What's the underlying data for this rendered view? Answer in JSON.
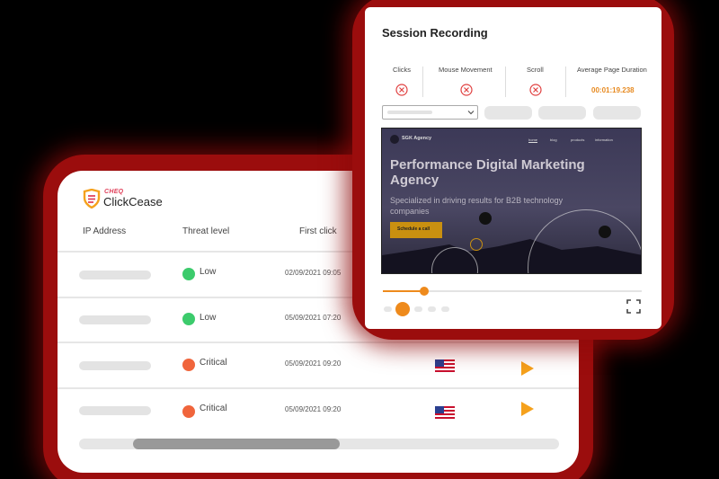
{
  "clickcease": {
    "brand_tag": "CHEQ",
    "brand_name": "ClickCease",
    "columns": [
      "IP Address",
      "Threat level",
      "First click"
    ],
    "rows": [
      {
        "threat": "Low",
        "status_color": "#3ccb6c",
        "first_click": "02/09/2021  09:05",
        "has_details": false
      },
      {
        "threat": "Low",
        "status_color": "#3ccb6c",
        "first_click": "05/09/2021  07:20",
        "has_details": false
      },
      {
        "threat": "Critical",
        "status_color": "#f0653c",
        "first_click": "05/09/2021  09:20",
        "has_details": true,
        "flag_icon": "us-flag-icon"
      },
      {
        "threat": "Critical",
        "status_color": "#f0653c",
        "first_click": "05/09/2021  09:20",
        "has_details": true,
        "flag_icon": "us-flag-icon"
      }
    ]
  },
  "session": {
    "title": "Session Recording",
    "metrics": [
      {
        "label": "Clicks",
        "icon": "x-circle-icon"
      },
      {
        "label": "Mouse Movement",
        "icon": "x-circle-icon"
      },
      {
        "label": "Scroll",
        "icon": "x-circle-icon"
      },
      {
        "label": "Average Page Duration",
        "value": "00:01:19.238"
      }
    ],
    "preview": {
      "brand": "SGK Agency",
      "nav": [
        "home",
        "blog",
        "products",
        "information"
      ],
      "headline": "Performance Digital Marketing Agency",
      "subheadline": "Specialized in driving results for B2B technology companies",
      "cta": "Schedule a call"
    },
    "playback_progress": 0.16
  },
  "colors": {
    "accent_orange": "#ee8a1c",
    "glow_red": "#9b0d0d",
    "low_green": "#3ccb6c",
    "critical_red": "#f0653c"
  }
}
